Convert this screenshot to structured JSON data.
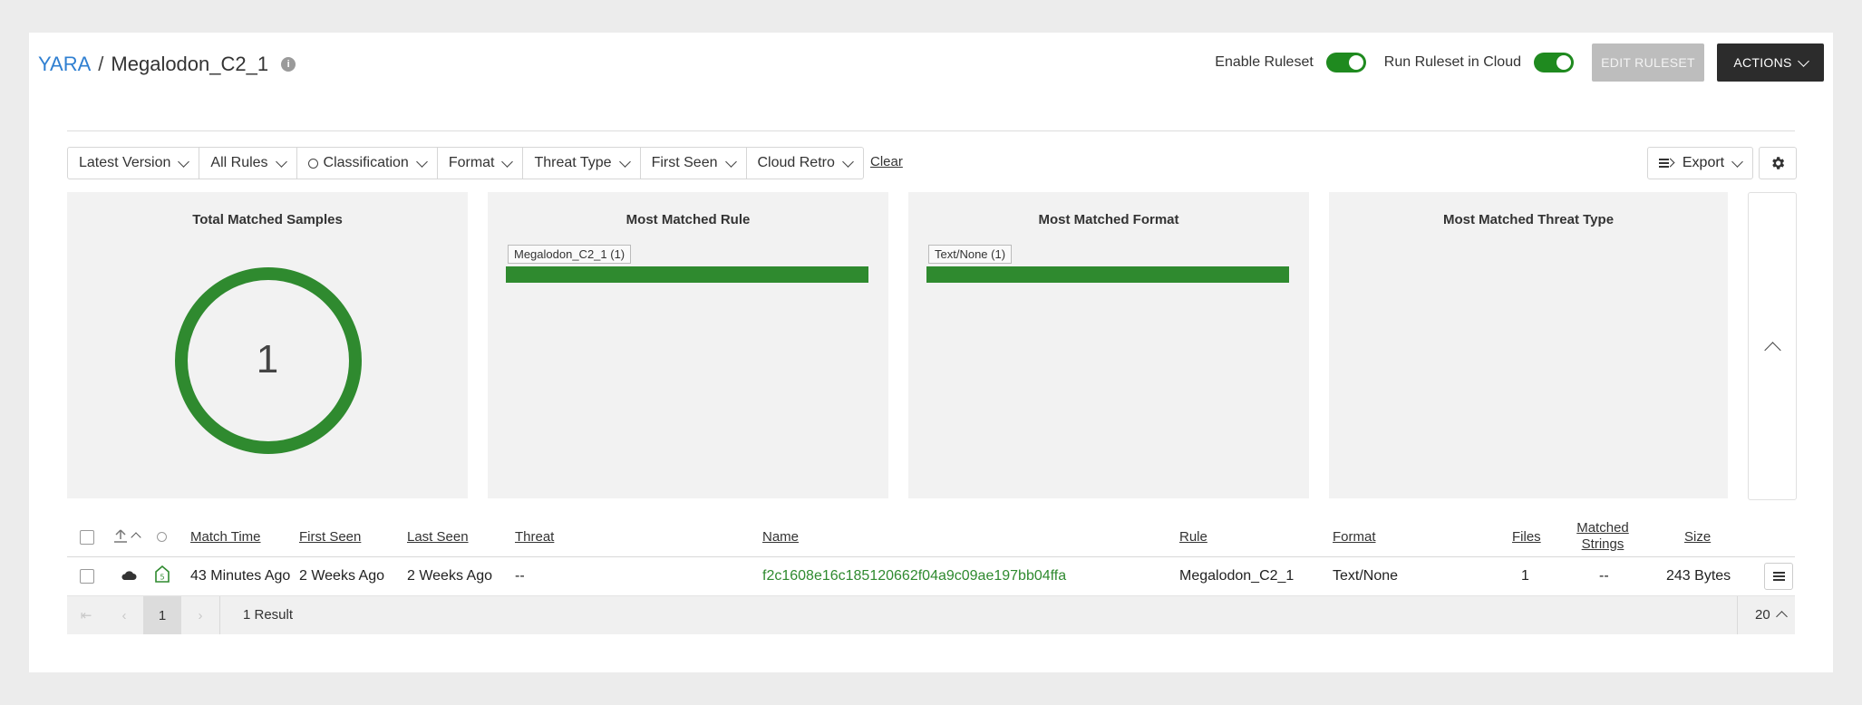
{
  "breadcrumb": {
    "root": "YARA",
    "separator": "/",
    "current": "Megalodon_C2_1"
  },
  "header": {
    "enable_ruleset_label": "Enable Ruleset",
    "run_cloud_label": "Run Ruleset in Cloud",
    "edit_button": "EDIT RULESET",
    "actions_button": "ACTIONS"
  },
  "filters": {
    "items": [
      "Latest Version",
      "All Rules",
      "Classification",
      "Format",
      "Threat Type",
      "First Seen",
      "Cloud Retro"
    ],
    "clear": "Clear",
    "export": "Export"
  },
  "panels": {
    "total": {
      "title": "Total Matched Samples",
      "value": "1"
    },
    "rule": {
      "title": "Most Matched Rule",
      "chip": "Megalodon_C2_1 (1)"
    },
    "format": {
      "title": "Most Matched Format",
      "chip": "Text/None (1)"
    },
    "threat": {
      "title": "Most Matched Threat Type"
    }
  },
  "table": {
    "headers": {
      "match_time": "Match Time",
      "first_seen": "First Seen",
      "last_seen": "Last Seen",
      "threat": "Threat",
      "name": "Name",
      "rule": "Rule",
      "format": "Format",
      "files": "Files",
      "matched_strings_1": "Matched",
      "matched_strings_2": "Strings",
      "size": "Size"
    },
    "row": {
      "match_time": "43 Minutes Ago",
      "first_seen": "2 Weeks Ago",
      "last_seen": "2 Weeks Ago",
      "threat": "--",
      "name": "f2c1608e16c185120662f04a9c09ae197bb04ffa",
      "rule": "Megalodon_C2_1",
      "format": "Text/None",
      "files": "1",
      "matched_strings": "--",
      "size": "243 Bytes"
    }
  },
  "pager": {
    "current_page": "1",
    "results": "1 Result",
    "per_page": "20"
  },
  "colors": {
    "accent_link": "#2f7fd1",
    "green": "#2f8a2f",
    "dark_button": "#2c2c2c"
  }
}
